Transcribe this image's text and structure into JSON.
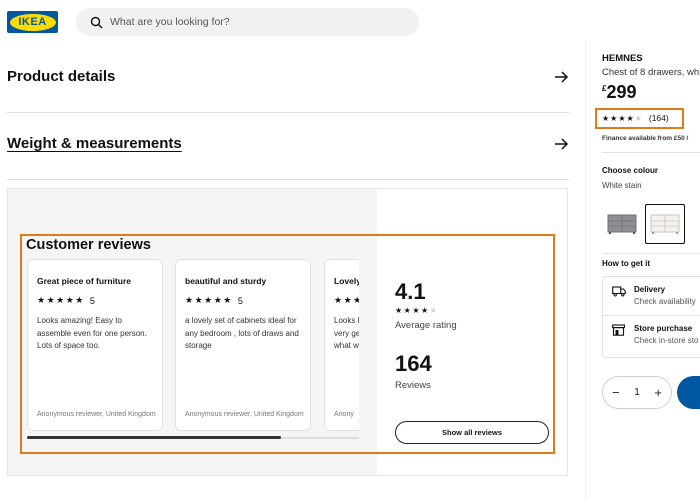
{
  "header": {
    "logo_text": "IKEA",
    "search_placeholder": "What are you looking for?",
    "brand_colors": {
      "blue": "#0058a3",
      "yellow": "#ffdb00"
    }
  },
  "accordion": [
    {
      "label": "Product details",
      "icon": "arrow-right-icon"
    },
    {
      "label": "Weight & measurements",
      "icon": "arrow-right-icon"
    }
  ],
  "reviews": {
    "title": "Customer reviews",
    "cards": [
      {
        "title": "Great piece of furniture",
        "stars": "★★★★★",
        "rating": "5",
        "body": "Looks amazing! Easy to assemble even for one person. Lots of space too.",
        "author": "Anonymous reviewer, United Kingdom"
      },
      {
        "title": "beautiful and sturdy",
        "stars": "★★★★★",
        "rating": "5",
        "body": "a lovely set of cabinets ideal for any bedroom , lots of draws and storage",
        "author": "Anonymous reviewer, United Kingdom"
      },
      {
        "title": "Lovely",
        "stars": "★★★★★",
        "rating": "",
        "body": "Looks l very ge what w",
        "author": "Anony"
      }
    ],
    "average_rating": "4.1",
    "average_label": "Average rating",
    "review_count": "164",
    "review_count_label": "Reviews",
    "show_all_label": "Show all reviews",
    "rating_stars_filled": 4,
    "rating_stars_total": 5,
    "highlight_color": "#e07b1a"
  },
  "product": {
    "name": "HEMNES",
    "description": "Chest of 8 drawers, wh",
    "price_currency": "£",
    "price_amount": "299",
    "rating_count": "(164)",
    "finance_text": "Finance available from £50 /",
    "colour_label": "Choose colour",
    "colour_value": "White stain",
    "how_to_get": "How to get it",
    "delivery_title": "Delivery",
    "delivery_sub": "Check availability",
    "store_title": "Store purchase",
    "store_sub": "Check in-store sto",
    "quantity": "1",
    "minus": "−",
    "plus": "+"
  }
}
